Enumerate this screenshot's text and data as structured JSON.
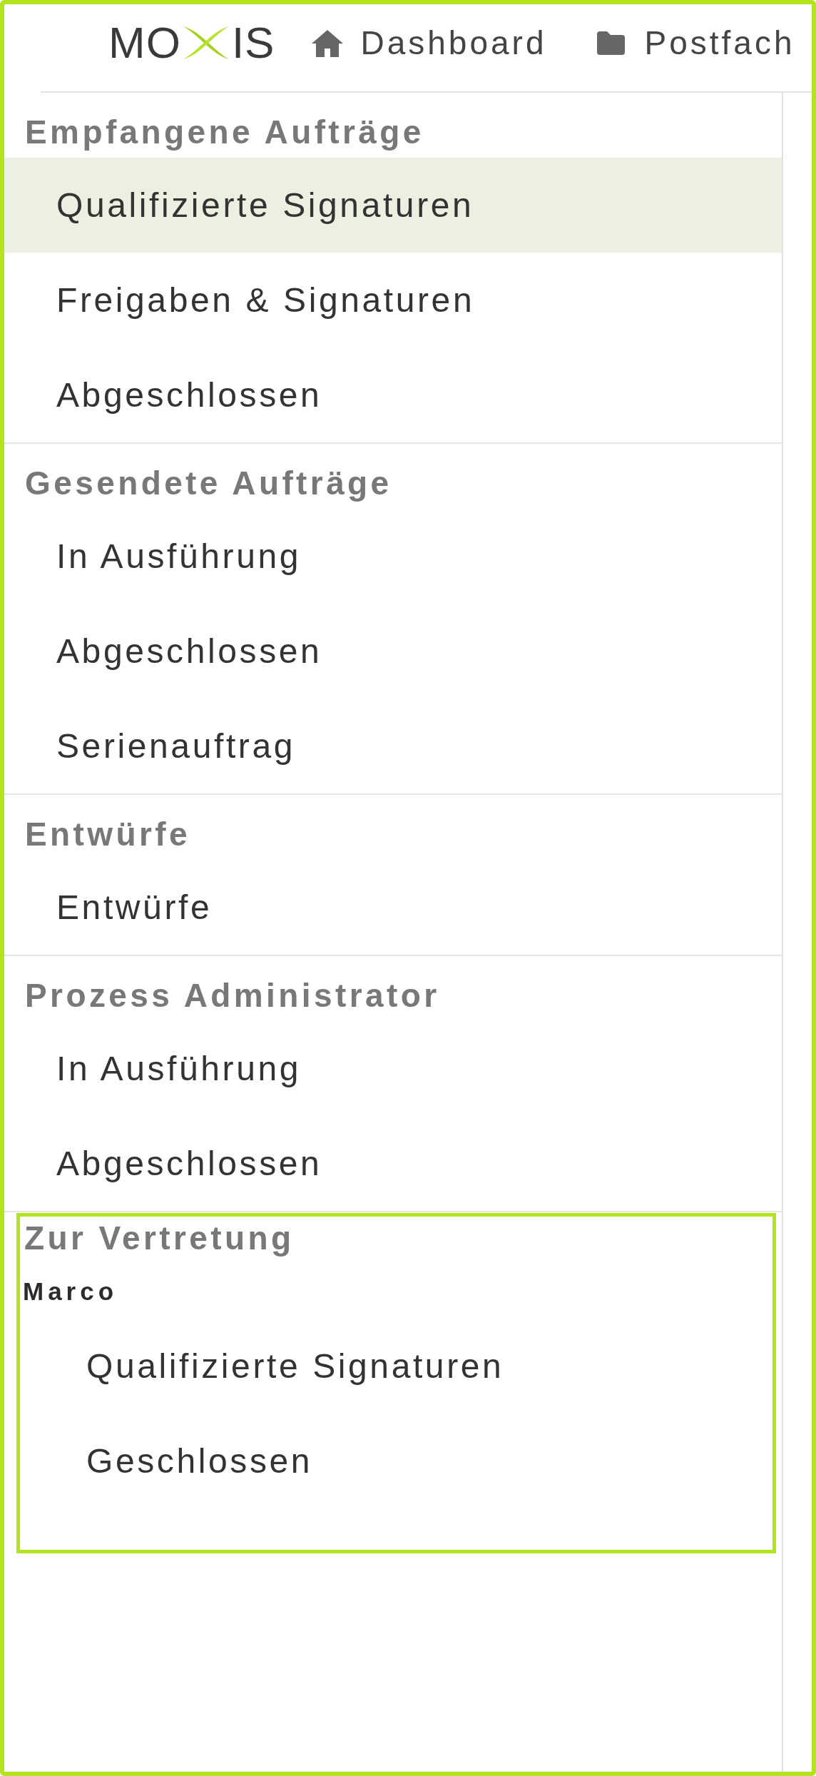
{
  "header": {
    "logo": {
      "text_before": "MO",
      "text_after": "IS"
    },
    "nav": [
      {
        "kind": "home",
        "label": "Dashboard"
      },
      {
        "kind": "folder",
        "label": "Postfach"
      }
    ]
  },
  "sidebar": {
    "sections": [
      {
        "kind": "list",
        "title": "Empfangene Aufträge",
        "highlighted": false,
        "items": [
          {
            "label": "Qualifizierte Signaturen",
            "selected": true
          },
          {
            "label": "Freigaben & Signaturen",
            "selected": false
          },
          {
            "label": "Abgeschlossen",
            "selected": false
          }
        ]
      },
      {
        "kind": "list",
        "title": "Gesendete Aufträge",
        "highlighted": false,
        "items": [
          {
            "label": "In Ausführung",
            "selected": false
          },
          {
            "label": "Abgeschlossen",
            "selected": false
          },
          {
            "label": "Serienauftrag",
            "selected": false
          }
        ]
      },
      {
        "kind": "list",
        "title": "Entwürfe",
        "highlighted": false,
        "items": [
          {
            "label": "Entwürfe",
            "selected": false
          }
        ]
      },
      {
        "kind": "list",
        "title": "Prozess Administrator",
        "highlighted": false,
        "items": [
          {
            "label": "In Ausführung",
            "selected": false
          },
          {
            "label": "Abgeschlossen",
            "selected": false
          }
        ]
      },
      {
        "kind": "delegation",
        "title": "Zur Vertretung",
        "highlighted": true,
        "groups": [
          {
            "name": "Marco",
            "items": [
              {
                "label": "Qualifizierte Signaturen",
                "selected": false
              },
              {
                "label": "Geschlossen",
                "selected": false
              }
            ]
          }
        ]
      }
    ]
  }
}
